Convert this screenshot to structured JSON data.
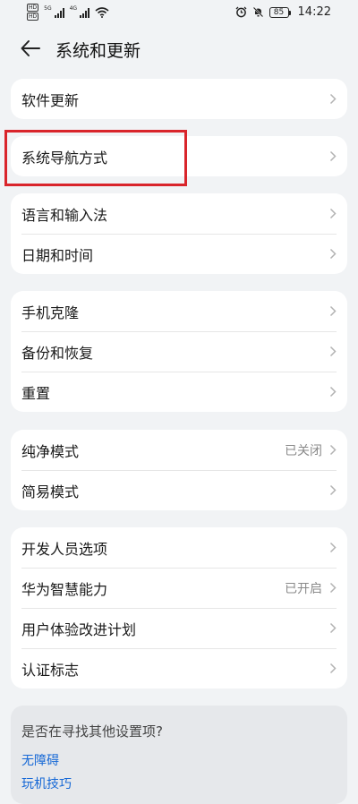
{
  "status": {
    "sim1": "HD",
    "sim2": "HD",
    "net1": "5G",
    "net2": "4G",
    "battery": "85",
    "time": "14:22"
  },
  "header": {
    "title": "系统和更新"
  },
  "groups": [
    {
      "items": [
        {
          "label": "软件更新",
          "value": ""
        }
      ]
    },
    {
      "items": [
        {
          "label": "系统导航方式",
          "value": ""
        }
      ]
    },
    {
      "items": [
        {
          "label": "语言和输入法",
          "value": ""
        },
        {
          "label": "日期和时间",
          "value": ""
        }
      ]
    },
    {
      "items": [
        {
          "label": "手机克隆",
          "value": ""
        },
        {
          "label": "备份和恢复",
          "value": ""
        },
        {
          "label": "重置",
          "value": ""
        }
      ]
    },
    {
      "items": [
        {
          "label": "纯净模式",
          "value": "已关闭"
        },
        {
          "label": "简易模式",
          "value": ""
        }
      ]
    },
    {
      "items": [
        {
          "label": "开发人员选项",
          "value": ""
        },
        {
          "label": "华为智慧能力",
          "value": "已开启"
        },
        {
          "label": "用户体验改进计划",
          "value": ""
        },
        {
          "label": "认证标志",
          "value": ""
        }
      ]
    }
  ],
  "suggest": {
    "question": "是否在寻找其他设置项?",
    "links": [
      "无障碍",
      "玩机技巧"
    ]
  },
  "colors": {
    "highlight": "#d9252b",
    "link": "#1668d6",
    "background": "#f1f3f5"
  }
}
